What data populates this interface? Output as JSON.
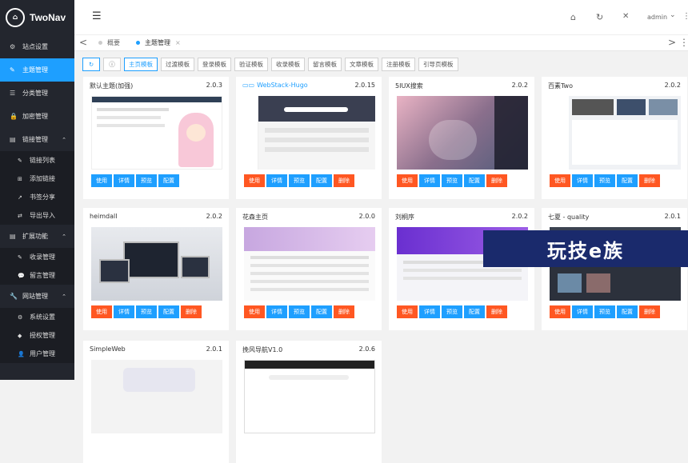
{
  "app": {
    "title": "TwoNav",
    "logo_mark": "⌂"
  },
  "sidebar": {
    "items": [
      {
        "label": "站点设置",
        "icon": "⚙"
      },
      {
        "label": "主题管理",
        "icon": "✎"
      },
      {
        "label": "分类管理",
        "icon": "☰"
      },
      {
        "label": "加密管理",
        "icon": "🔒"
      }
    ],
    "group_links": {
      "label": "链接管理",
      "icon": "▤",
      "caret": "⌃",
      "items": [
        {
          "label": "链接列表",
          "icon": "✎"
        },
        {
          "label": "添加链接",
          "icon": "⊞"
        },
        {
          "label": "书签分享",
          "icon": "↗"
        },
        {
          "label": "导出导入",
          "icon": "⇄"
        }
      ]
    },
    "group_ext": {
      "label": "扩展功能",
      "icon": "▤",
      "caret": "⌃",
      "items": [
        {
          "label": "收录管理",
          "icon": "✎"
        },
        {
          "label": "留言管理",
          "icon": "💬"
        }
      ]
    },
    "group_site": {
      "label": "网站管理",
      "icon": "🔧",
      "caret": "⌃",
      "items": [
        {
          "label": "系统设置",
          "icon": "⚙"
        },
        {
          "label": "授权管理",
          "icon": "◆"
        },
        {
          "label": "用户管理",
          "icon": "👤"
        }
      ]
    }
  },
  "header": {
    "menu_icon": "☰",
    "home_icon": "⌂",
    "refresh_icon": "↻",
    "fullscreen_icon": "✕",
    "user": "admin",
    "user_caret": "⌄",
    "more_icon": "⋮"
  },
  "tabs": {
    "prev": "<",
    "next": ">",
    "more": "⋮",
    "items": [
      {
        "label": "概要"
      },
      {
        "label": "主题管理",
        "close": "×"
      }
    ]
  },
  "toolbar": {
    "refresh": "↻",
    "info": "ⓘ",
    "buttons": [
      "主页模板",
      "过渡模板",
      "登录模板",
      "验证模板",
      "收录模板",
      "留言模板",
      "文章模板",
      "注册模板",
      "引导页模板"
    ]
  },
  "actions": {
    "use": "使用",
    "detail": "详情",
    "preview": "预览",
    "config": "配置",
    "delete": "删除"
  },
  "themes": [
    {
      "name": "默认主题(加强)",
      "version": "2.0.3"
    },
    {
      "name": "WebStack-Hugo",
      "version": "2.0.15"
    },
    {
      "name": "5IUX搜索",
      "version": "2.0.2"
    },
    {
      "name": "百素Two",
      "version": "2.0.2"
    },
    {
      "name": "heimdall",
      "version": "2.0.2"
    },
    {
      "name": "花森主页",
      "version": "2.0.0"
    },
    {
      "name": "刘桐序",
      "version": "2.0.2"
    },
    {
      "name": "七夏 - quality",
      "version": "2.0.1"
    },
    {
      "name": "SimpleWeb",
      "version": "2.0.1"
    },
    {
      "name": "挽风导航V1.0",
      "version": "2.0.6"
    }
  ],
  "watermark": "玩技e族",
  "colors": {
    "primary": "#1e9fff",
    "danger": "#ff5722",
    "sidebar": "#23262e"
  }
}
